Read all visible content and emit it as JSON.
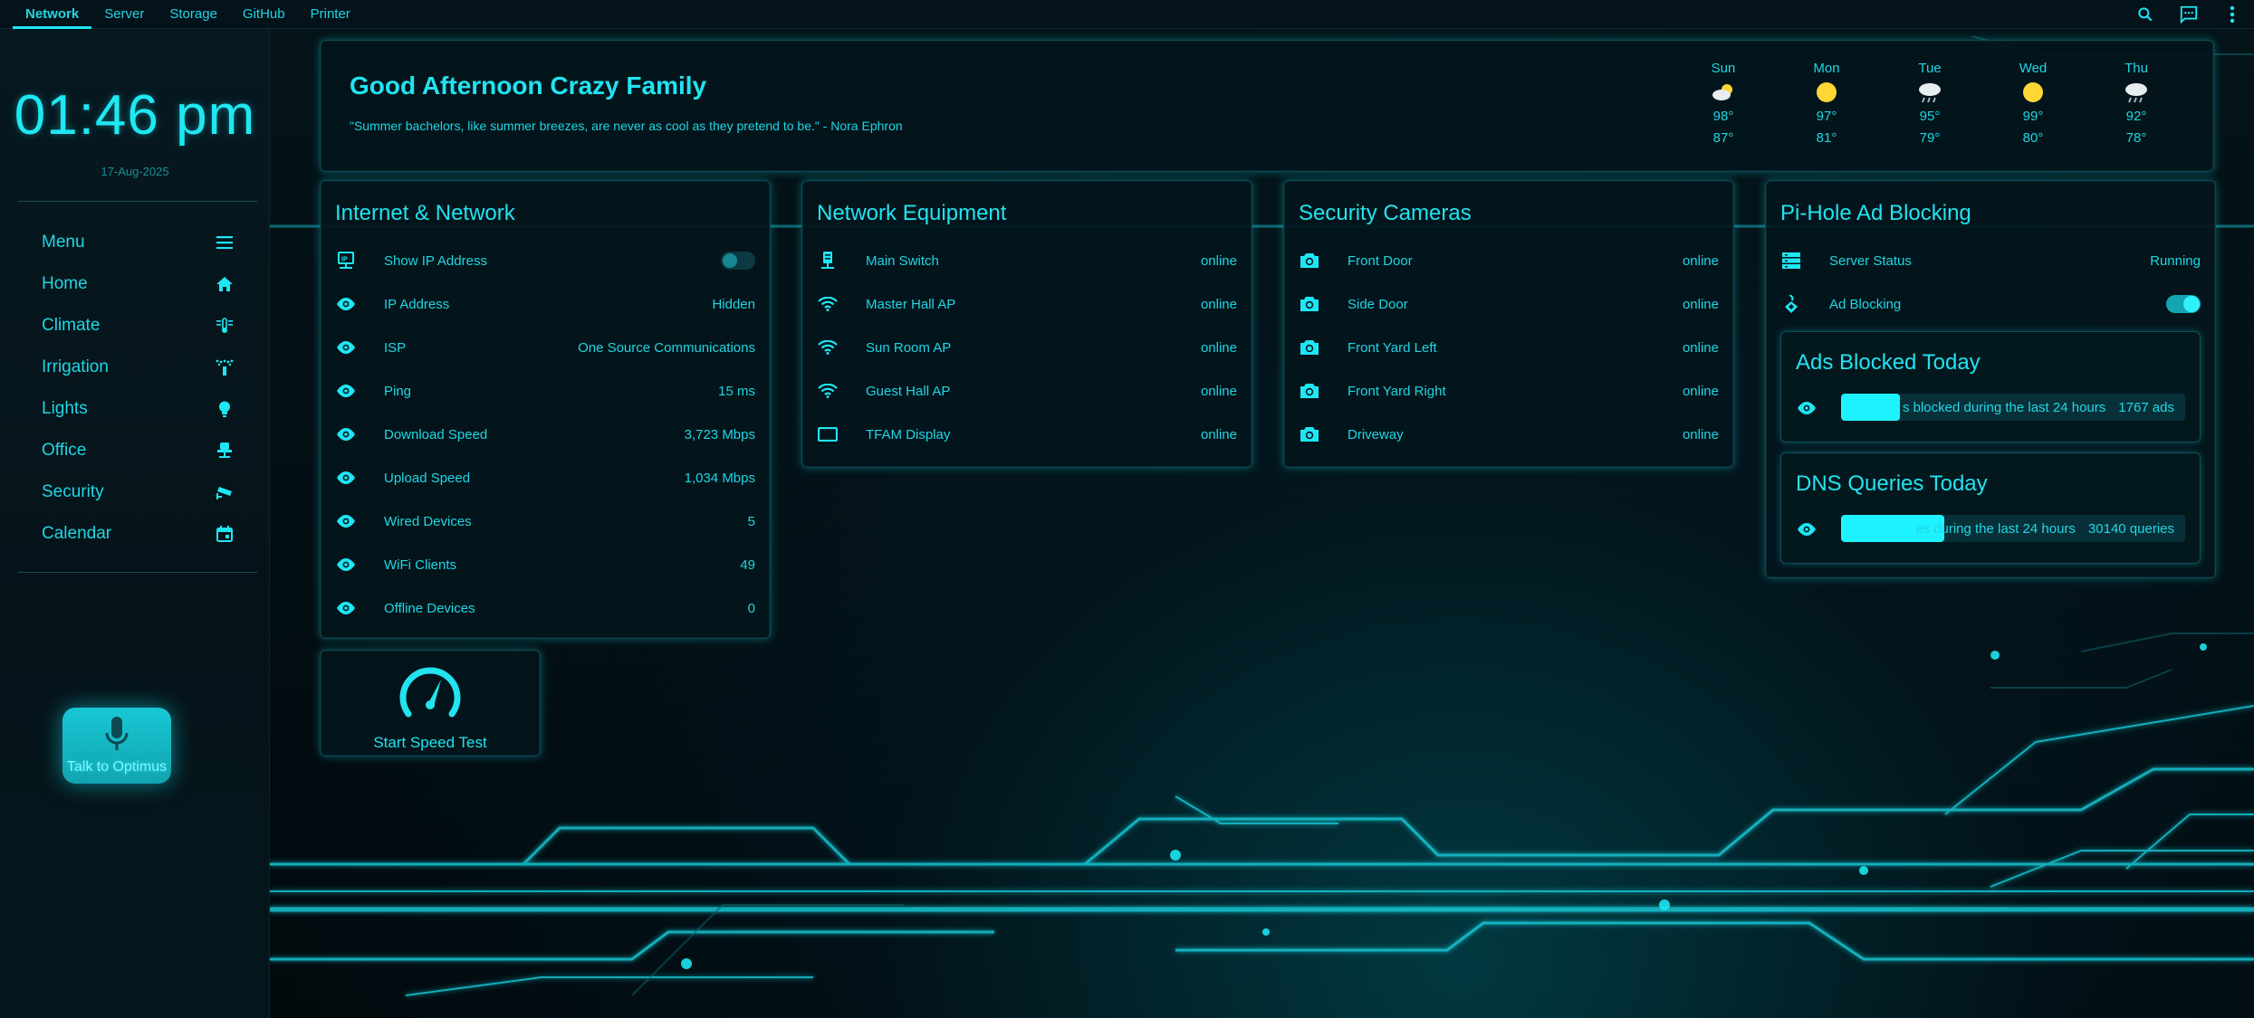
{
  "tabs": [
    {
      "label": "Network",
      "active": true
    },
    {
      "label": "Server",
      "active": false
    },
    {
      "label": "Storage",
      "active": false
    },
    {
      "label": "GitHub",
      "active": false
    },
    {
      "label": "Printer",
      "active": false
    }
  ],
  "topbar_icons": [
    "search-icon",
    "chat-icon",
    "more-vertical-icon"
  ],
  "sidebar": {
    "time": "01:46 pm",
    "date": "17-Aug-2025",
    "menu": [
      {
        "label": "Menu",
        "icon": "hamburger-icon"
      },
      {
        "label": "Home",
        "icon": "home-icon"
      },
      {
        "label": "Climate",
        "icon": "thermostat-icon"
      },
      {
        "label": "Irrigation",
        "icon": "sprinkler-icon"
      },
      {
        "label": "Lights",
        "icon": "lightbulb-icon"
      },
      {
        "label": "Office",
        "icon": "office-chair-icon"
      },
      {
        "label": "Security",
        "icon": "cctv-icon"
      },
      {
        "label": "Calendar",
        "icon": "calendar-icon"
      }
    ],
    "voice_button": "Talk to Optimus"
  },
  "header": {
    "greeting": "Good Afternoon Crazy Family",
    "quote": "\"Summer bachelors, like summer breezes, are never as cool as they pretend to be.\" - Nora Ephron",
    "forecast": [
      {
        "day": "Sun",
        "icon": "partly-cloudy-icon",
        "high": "98°",
        "low": "87°"
      },
      {
        "day": "Mon",
        "icon": "sunny-icon",
        "high": "97°",
        "low": "81°"
      },
      {
        "day": "Tue",
        "icon": "rainy-icon",
        "high": "95°",
        "low": "79°"
      },
      {
        "day": "Wed",
        "icon": "sunny-icon",
        "high": "99°",
        "low": "80°"
      },
      {
        "day": "Thu",
        "icon": "rainy-icon",
        "high": "92°",
        "low": "78°"
      }
    ]
  },
  "internet": {
    "title": "Internet & Network",
    "rows": [
      {
        "label": "Show IP Address",
        "value": "",
        "icon": "ip-network-icon",
        "toggle": "off"
      },
      {
        "label": "IP Address",
        "value": "Hidden",
        "icon": "eye-icon"
      },
      {
        "label": "ISP",
        "value": "One Source Communications",
        "icon": "eye-icon"
      },
      {
        "label": "Ping",
        "value": "15 ms",
        "icon": "eye-icon"
      },
      {
        "label": "Download Speed",
        "value": "3,723 Mbps",
        "icon": "eye-icon"
      },
      {
        "label": "Upload Speed",
        "value": "1,034 Mbps",
        "icon": "eye-icon"
      },
      {
        "label": "Wired Devices",
        "value": "5",
        "icon": "eye-icon"
      },
      {
        "label": "WiFi Clients",
        "value": "49",
        "icon": "eye-icon"
      },
      {
        "label": "Offline Devices",
        "value": "0",
        "icon": "eye-icon"
      }
    ],
    "speed_test_label": "Start Speed Test"
  },
  "equipment": {
    "title": "Network Equipment",
    "rows": [
      {
        "label": "Main Switch",
        "value": "online",
        "icon": "switch-icon"
      },
      {
        "label": "Master Hall AP",
        "value": "online",
        "icon": "wifi-icon"
      },
      {
        "label": "Sun Room AP",
        "value": "online",
        "icon": "wifi-icon"
      },
      {
        "label": "Guest Hall AP",
        "value": "online",
        "icon": "wifi-icon"
      },
      {
        "label": "TFAM Display",
        "value": "online",
        "icon": "tablet-icon"
      }
    ]
  },
  "cameras": {
    "title": "Security Cameras",
    "rows": [
      {
        "label": "Front Door",
        "value": "online",
        "icon": "camera-icon"
      },
      {
        "label": "Side Door",
        "value": "online",
        "icon": "camera-icon"
      },
      {
        "label": "Front Yard Left",
        "value": "online",
        "icon": "camera-icon"
      },
      {
        "label": "Front Yard Right",
        "value": "online",
        "icon": "camera-icon"
      },
      {
        "label": "Driveway",
        "value": "online",
        "icon": "camera-icon"
      }
    ]
  },
  "pihole": {
    "title": "Pi-Hole Ad Blocking",
    "server_status_label": "Server Status",
    "server_status_value": "Running",
    "ad_blocking_label": "Ad Blocking",
    "ad_blocking_toggle": "on",
    "ads_blocked": {
      "title": "Ads Blocked Today",
      "text": "s blocked during the last 24 hours",
      "value": "1767 ads",
      "fill_fraction": 0.17
    },
    "dns_queries": {
      "title": "DNS Queries Today",
      "text": "es during the last 24 hours",
      "value": "30140 queries",
      "fill_fraction": 0.3
    }
  },
  "colors": {
    "accent": "#1fe6f4",
    "background": "#02090d",
    "card": "#03161c",
    "sun": "#ffd633"
  }
}
